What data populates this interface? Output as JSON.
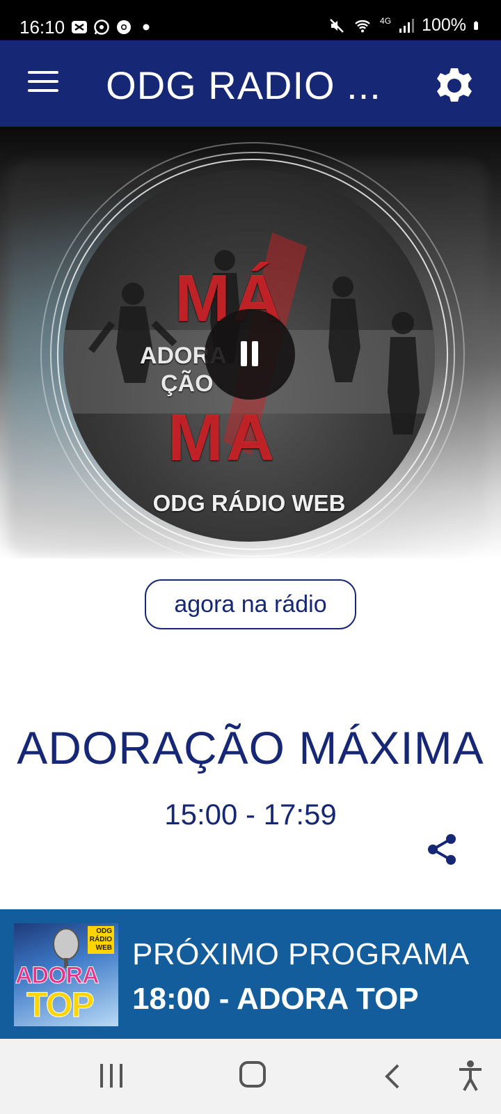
{
  "status_bar": {
    "time": "16:10",
    "battery": "100%",
    "network": "4G"
  },
  "app_bar": {
    "title": "ODG RADIO ..."
  },
  "player": {
    "cover_text": {
      "word1": "ADORA",
      "word2": "ÇÃO",
      "ma_top": "MÁ",
      "ma_bottom": "MA",
      "station": "ODG RÁDIO WEB"
    },
    "state": "playing"
  },
  "now_playing": {
    "label": "agora na rádio",
    "program": "ADORAÇÃO MÁXIMA",
    "time": "15:00 - 17:59"
  },
  "next_program": {
    "label": "PRÓXIMO PROGRAMA",
    "value": "18:00 - ADORA TOP",
    "thumb": {
      "station_line1": "ODG",
      "station_line2": "RÁDIO",
      "station_line3": "WEB",
      "word1": "ADORA",
      "word2": "TOP"
    }
  },
  "colors": {
    "brand": "#152775",
    "banner": "#135d9d"
  }
}
